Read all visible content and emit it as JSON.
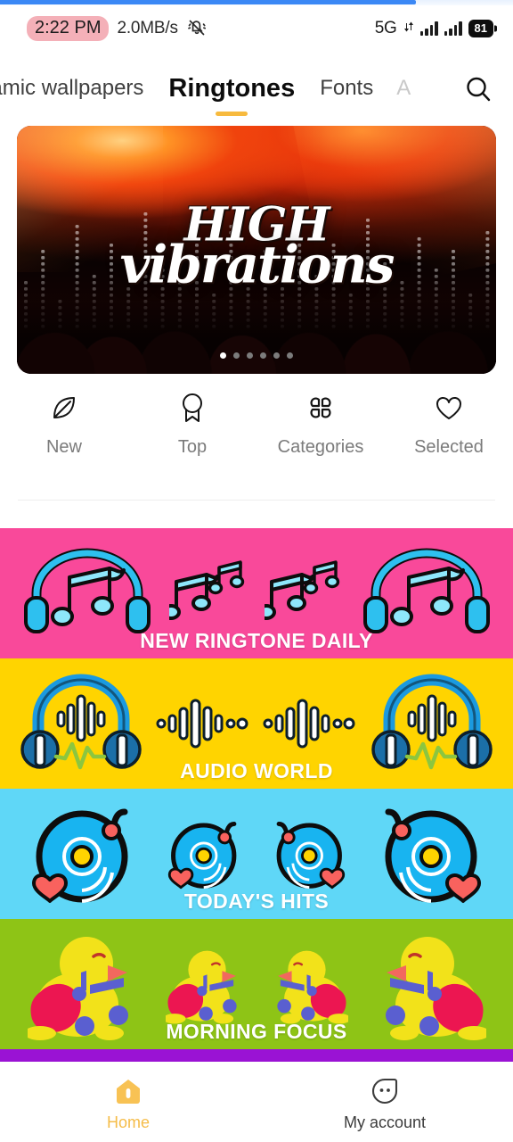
{
  "status_bar": {
    "time": "2:22 PM",
    "network_speed": "2.0MB/s",
    "silent_icon": "bell-muted-icon",
    "network_type": "5G",
    "battery_percent": "81",
    "download_progress": 81
  },
  "tabs": {
    "items": [
      {
        "label": "namic wallpapers",
        "state": "truncated"
      },
      {
        "label": "Ringtones",
        "state": "active"
      },
      {
        "label": "Fonts",
        "state": "normal"
      },
      {
        "label": "A",
        "state": "faded"
      }
    ],
    "search_icon": "search-icon",
    "active_underline_color": "#f7ba3e"
  },
  "hero": {
    "title_line1": "HIGH",
    "title_line2": "vibrations",
    "dot_count": 6,
    "active_dot": 0
  },
  "quick_actions": [
    {
      "label": "New",
      "icon": "leaf-icon"
    },
    {
      "label": "Top",
      "icon": "award-ribbon-icon"
    },
    {
      "label": "Categories",
      "icon": "grid-petals-icon"
    },
    {
      "label": "Selected",
      "icon": "heart-icon"
    }
  ],
  "categories": [
    {
      "label": "NEW RINGTONE DAILY",
      "background": "#f9499a",
      "art": "headphones-music-notes",
      "accent": "#29b6e8"
    },
    {
      "label": "AUDIO WORLD",
      "background": "#ffd400",
      "art": "headphones-waveform",
      "accent": "#2196e3"
    },
    {
      "label": "TODAY'S HITS",
      "background": "#5fd7f7",
      "art": "vinyl-record-heart",
      "accent": "#18b4f0"
    },
    {
      "label": "MORNING FOCUS",
      "background": "#8ec416",
      "art": "singing-bird-notes",
      "accent": "#f2e21a"
    },
    {
      "label": "",
      "background": "#9a13d4",
      "art": "peek",
      "accent": "#9a13d4"
    }
  ],
  "bottom_nav": [
    {
      "label": "Home",
      "icon": "home-icon",
      "active": true
    },
    {
      "label": "My account",
      "icon": "account-face-icon",
      "active": false
    }
  ]
}
